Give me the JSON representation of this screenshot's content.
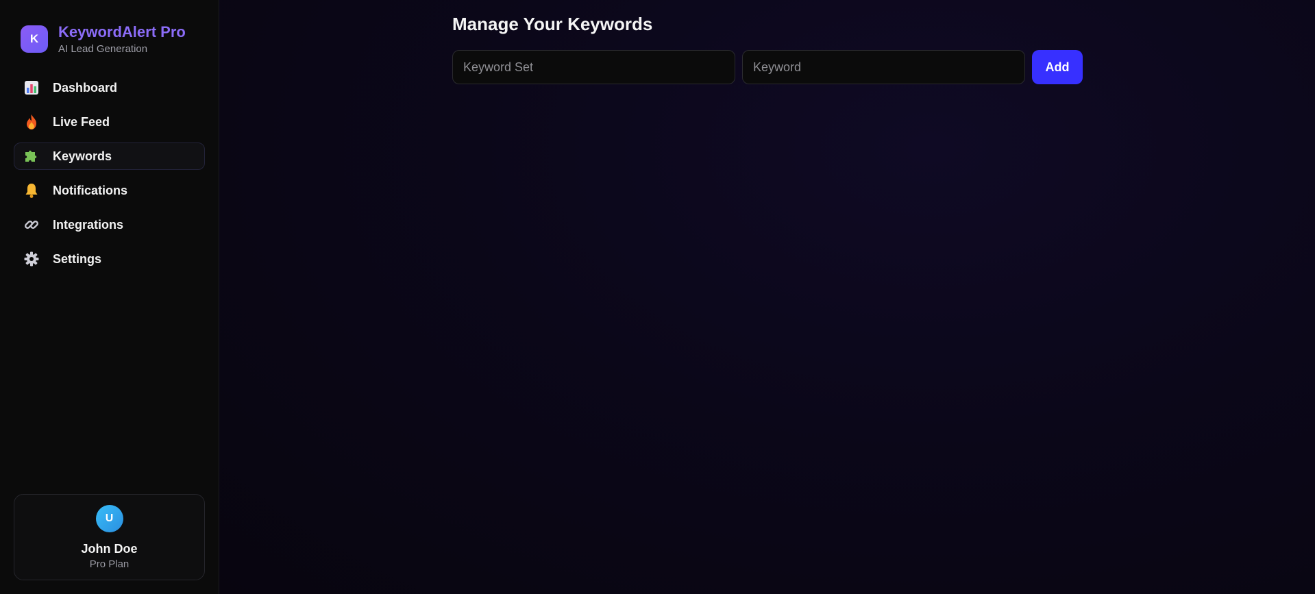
{
  "brand": {
    "logo_letter": "K",
    "title": "KeywordAlert Pro",
    "subtitle": "AI Lead Generation",
    "accent_color": "#8b6cf7"
  },
  "sidebar": {
    "items": [
      {
        "label": "Dashboard",
        "icon": "bar-chart-icon",
        "active": false
      },
      {
        "label": "Live Feed",
        "icon": "fire-icon",
        "active": false
      },
      {
        "label": "Keywords",
        "icon": "puzzle-icon",
        "active": true
      },
      {
        "label": "Notifications",
        "icon": "bell-icon",
        "active": false
      },
      {
        "label": "Integrations",
        "icon": "link-icon",
        "active": false
      },
      {
        "label": "Settings",
        "icon": "gear-icon",
        "active": false
      }
    ]
  },
  "user": {
    "avatar_letter": "U",
    "name": "John Doe",
    "plan": "Pro Plan"
  },
  "main": {
    "title": "Manage Your Keywords",
    "keyword_set_placeholder": "Keyword Set",
    "keyword_set_value": "",
    "keyword_placeholder": "Keyword",
    "keyword_value": "",
    "add_label": "Add",
    "button_color": "#3730ff"
  }
}
